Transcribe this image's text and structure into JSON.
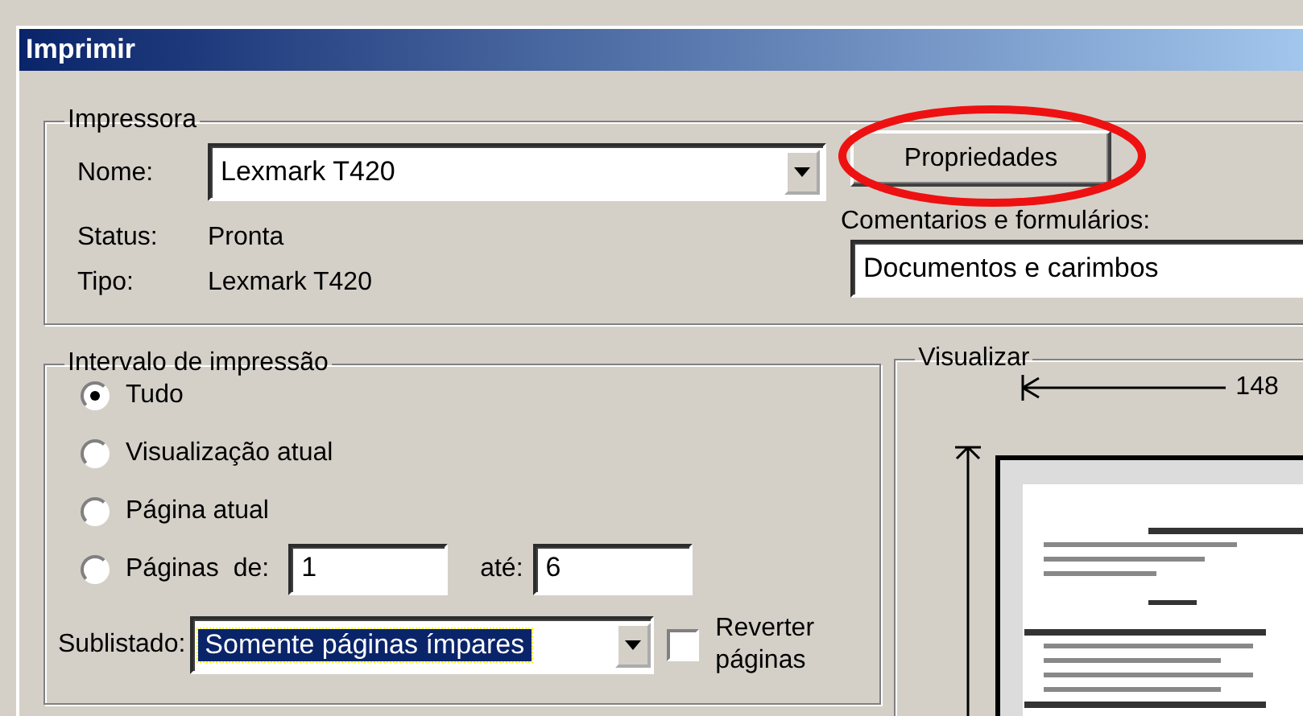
{
  "window": {
    "title": "Imprimir"
  },
  "printer": {
    "legend": "Impressora",
    "name_label": "Nome:",
    "name_value": "Lexmark T420",
    "status_label": "Status:",
    "status_value": "Pronta",
    "type_label": "Tipo:",
    "type_value": "Lexmark T420",
    "properties_button": "Propriedades",
    "comments_label": "Comentarios e formulários:",
    "comments_value": "Documentos e carimbos"
  },
  "annotation": {
    "kind": "ellipse"
  },
  "print_range": {
    "legend": "Intervalo de impressão",
    "options": [
      {
        "label": "Tudo",
        "selected": true,
        "kind": "plain"
      },
      {
        "label": "Visualização atual",
        "selected": false,
        "kind": "plain"
      },
      {
        "label": "Página atual",
        "selected": false,
        "kind": "plain"
      },
      {
        "label": "Páginas",
        "selected": false,
        "kind": "range"
      }
    ],
    "from_label": "de:",
    "from_value": "1",
    "to_label": "até:",
    "to_value": "6",
    "subset_label": "Sublistado:",
    "subset_value": "Somente páginas ímpares",
    "reverse_label": "Reverter páginas",
    "reverse_checked": false
  },
  "preview": {
    "legend": "Visualizar",
    "width_label": "148"
  }
}
